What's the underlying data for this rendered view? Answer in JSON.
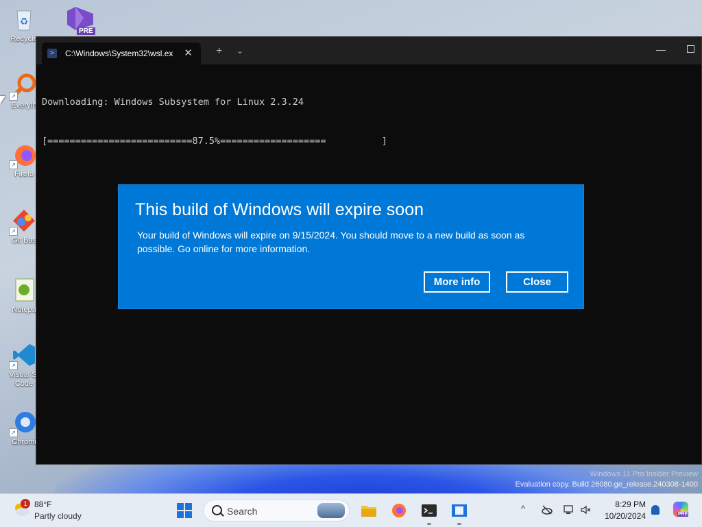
{
  "desktop": {
    "icons": [
      {
        "label": "Recycle",
        "icon": "recycle-bin-icon"
      },
      {
        "label": "PRE",
        "icon": "visual-studio-preview-icon"
      },
      {
        "label": "Everyth",
        "icon": "everything-search-icon"
      },
      {
        "label": "Firefo",
        "icon": "firefox-icon"
      },
      {
        "label": "Git Bas",
        "icon": "git-bash-icon"
      },
      {
        "label": "Notepa",
        "icon": "notepad-plus-plus-icon"
      },
      {
        "label": "Visual St",
        "label2": "Code",
        "icon": "vscode-icon"
      },
      {
        "label": "Chromi",
        "icon": "chromium-icon"
      }
    ]
  },
  "terminal": {
    "tab_title": "C:\\Windows\\System32\\wsl.ex",
    "tab_close": "✕",
    "new_tab": "+",
    "dropdown": "⌄",
    "minimize": "—",
    "console_line1": "Downloading: Windows Subsystem for Linux 2.3.24",
    "console_line2": "[==========================87.5%===================          ]",
    "progress_percent": 87.5
  },
  "dialog": {
    "title": "This build of Windows will expire soon",
    "body": "Your build of Windows will expire on 9/15/2024. You should move to a new build as soon as possible. Go online for more information.",
    "more_info": "More info",
    "close": "Close",
    "background_color": "#0078d7"
  },
  "watermark": {
    "line1": "Windows 11 Pro Insider Preview",
    "line2": "Evaluation copy. Build 26080.ge_release.240308-1400"
  },
  "taskbar": {
    "weather_badge": "1",
    "weather_temp": "88°F",
    "weather_condition": "Partly cloudy",
    "search_placeholder": "Search",
    "clock_time": "8:29 PM",
    "clock_date": "10/20/2024",
    "tray_chevron": "^",
    "copilot_badge": "PRE"
  }
}
